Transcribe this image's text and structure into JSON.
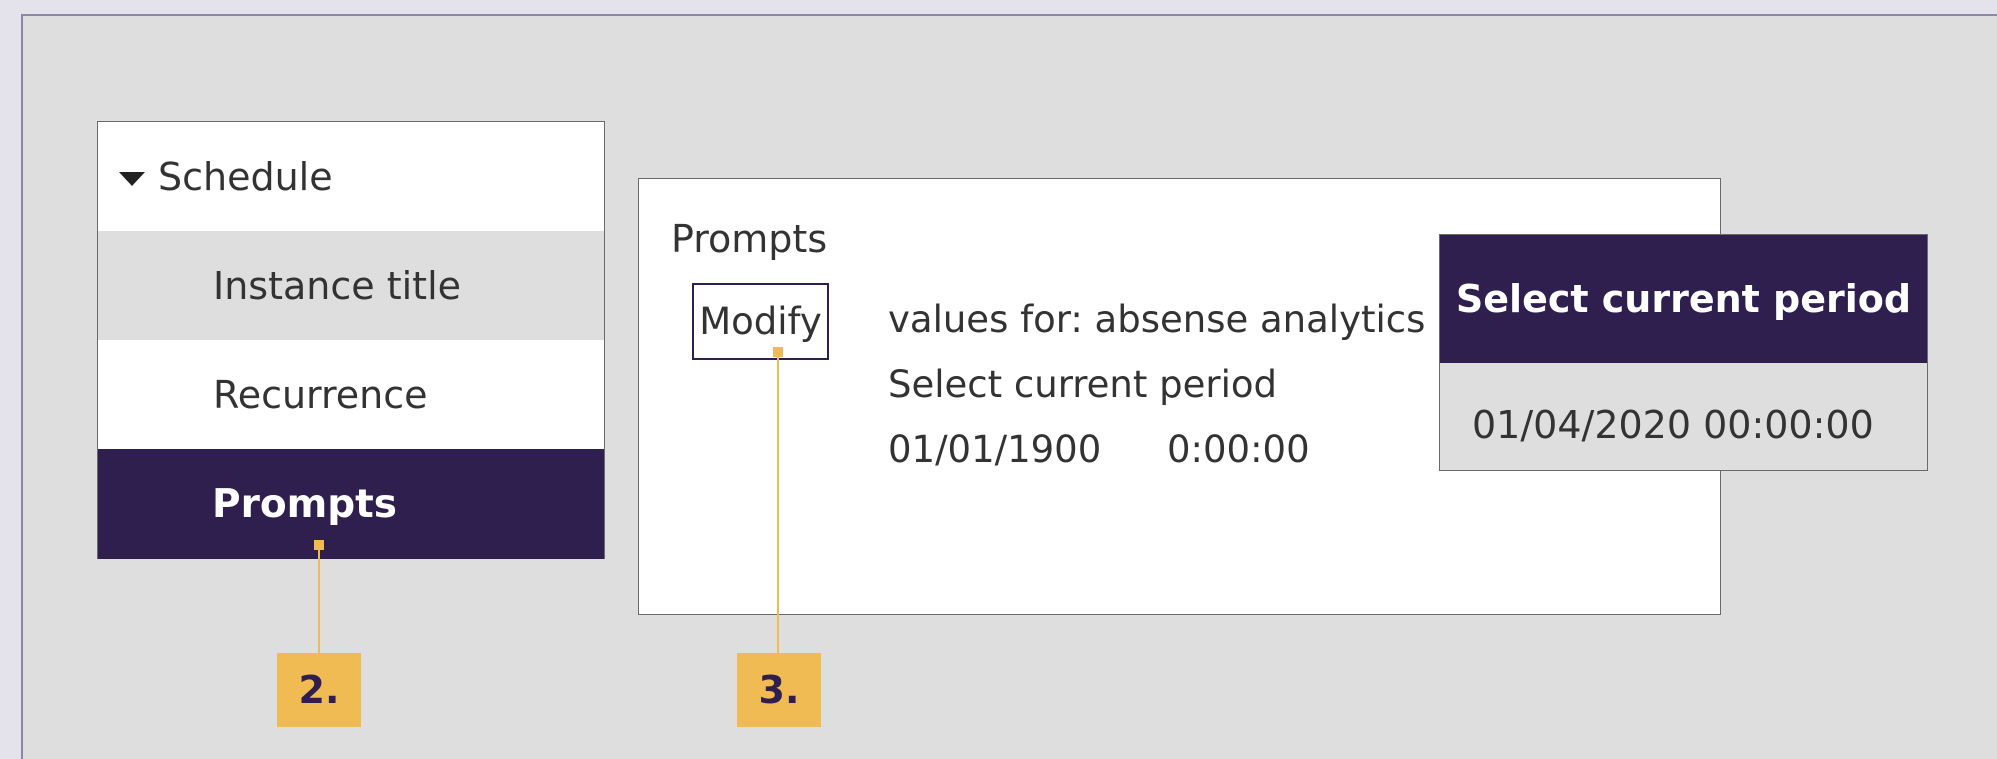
{
  "sidebar": {
    "section_label": "Schedule",
    "items": [
      {
        "label": "Instance title"
      },
      {
        "label": "Recurrence"
      },
      {
        "label": "Prompts"
      }
    ]
  },
  "main": {
    "title": "Prompts",
    "modify_label": "Modify",
    "values_for": "values for: absense analytics",
    "prompt_label": "Select current period",
    "date_value": "01/01/1900",
    "time_value": "0:00:00"
  },
  "popup": {
    "title": "Select current period",
    "value": "01/04/2020 00:00:00"
  },
  "callouts": [
    {
      "label": "2."
    },
    {
      "label": "3."
    }
  ],
  "colors": {
    "accent": "#2f1f4e",
    "callout": "#f0bb52",
    "background": "#dedede"
  }
}
